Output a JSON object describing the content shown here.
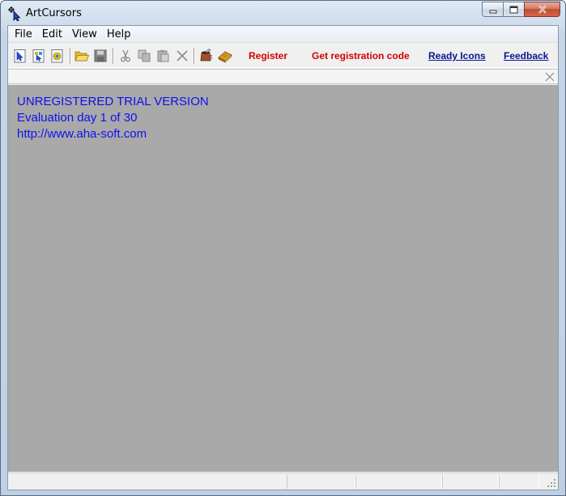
{
  "window": {
    "title": "ArtCursors",
    "app_icon": "cursor-arrow-icon",
    "caption_buttons": [
      "minimize-icon",
      "maximize-icon",
      "close-icon"
    ]
  },
  "menu": {
    "items": [
      "File",
      "Edit",
      "View",
      "Help"
    ]
  },
  "toolbar": {
    "icons": [
      "new-cursor-icon",
      "new-animated-cursor-icon",
      "new-icon-icon",
      "open-folder-icon",
      "save-disk-icon",
      "cut-icon",
      "copy-icon",
      "paste-icon",
      "delete-icon",
      "effects-icon",
      "library-book-icon"
    ],
    "links": {
      "register": "Register",
      "get_code": "Get registration code",
      "ready_icons": "Ready Icons",
      "feedback": "Feedback"
    }
  },
  "workspace": {
    "lines": [
      "UNREGISTERED TRIAL VERSION",
      "Evaluation day 1 of 30",
      "http://www.aha-soft.com"
    ],
    "background": "#a9a9a9",
    "text_color": "#1010ee"
  },
  "colors": {
    "link_red": "#d20000",
    "link_blue": "#0a1590"
  }
}
